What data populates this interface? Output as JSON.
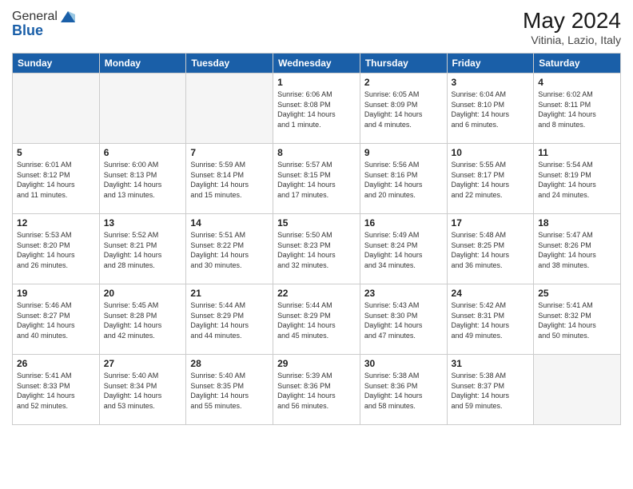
{
  "header": {
    "logo_general": "General",
    "logo_blue": "Blue",
    "month_title": "May 2024",
    "location": "Vitinia, Lazio, Italy"
  },
  "days_of_week": [
    "Sunday",
    "Monday",
    "Tuesday",
    "Wednesday",
    "Thursday",
    "Friday",
    "Saturday"
  ],
  "weeks": [
    [
      {
        "day": "",
        "info": ""
      },
      {
        "day": "",
        "info": ""
      },
      {
        "day": "",
        "info": ""
      },
      {
        "day": "1",
        "info": "Sunrise: 6:06 AM\nSunset: 8:08 PM\nDaylight: 14 hours\nand 1 minute."
      },
      {
        "day": "2",
        "info": "Sunrise: 6:05 AM\nSunset: 8:09 PM\nDaylight: 14 hours\nand 4 minutes."
      },
      {
        "day": "3",
        "info": "Sunrise: 6:04 AM\nSunset: 8:10 PM\nDaylight: 14 hours\nand 6 minutes."
      },
      {
        "day": "4",
        "info": "Sunrise: 6:02 AM\nSunset: 8:11 PM\nDaylight: 14 hours\nand 8 minutes."
      }
    ],
    [
      {
        "day": "5",
        "info": "Sunrise: 6:01 AM\nSunset: 8:12 PM\nDaylight: 14 hours\nand 11 minutes."
      },
      {
        "day": "6",
        "info": "Sunrise: 6:00 AM\nSunset: 8:13 PM\nDaylight: 14 hours\nand 13 minutes."
      },
      {
        "day": "7",
        "info": "Sunrise: 5:59 AM\nSunset: 8:14 PM\nDaylight: 14 hours\nand 15 minutes."
      },
      {
        "day": "8",
        "info": "Sunrise: 5:57 AM\nSunset: 8:15 PM\nDaylight: 14 hours\nand 17 minutes."
      },
      {
        "day": "9",
        "info": "Sunrise: 5:56 AM\nSunset: 8:16 PM\nDaylight: 14 hours\nand 20 minutes."
      },
      {
        "day": "10",
        "info": "Sunrise: 5:55 AM\nSunset: 8:17 PM\nDaylight: 14 hours\nand 22 minutes."
      },
      {
        "day": "11",
        "info": "Sunrise: 5:54 AM\nSunset: 8:19 PM\nDaylight: 14 hours\nand 24 minutes."
      }
    ],
    [
      {
        "day": "12",
        "info": "Sunrise: 5:53 AM\nSunset: 8:20 PM\nDaylight: 14 hours\nand 26 minutes."
      },
      {
        "day": "13",
        "info": "Sunrise: 5:52 AM\nSunset: 8:21 PM\nDaylight: 14 hours\nand 28 minutes."
      },
      {
        "day": "14",
        "info": "Sunrise: 5:51 AM\nSunset: 8:22 PM\nDaylight: 14 hours\nand 30 minutes."
      },
      {
        "day": "15",
        "info": "Sunrise: 5:50 AM\nSunset: 8:23 PM\nDaylight: 14 hours\nand 32 minutes."
      },
      {
        "day": "16",
        "info": "Sunrise: 5:49 AM\nSunset: 8:24 PM\nDaylight: 14 hours\nand 34 minutes."
      },
      {
        "day": "17",
        "info": "Sunrise: 5:48 AM\nSunset: 8:25 PM\nDaylight: 14 hours\nand 36 minutes."
      },
      {
        "day": "18",
        "info": "Sunrise: 5:47 AM\nSunset: 8:26 PM\nDaylight: 14 hours\nand 38 minutes."
      }
    ],
    [
      {
        "day": "19",
        "info": "Sunrise: 5:46 AM\nSunset: 8:27 PM\nDaylight: 14 hours\nand 40 minutes."
      },
      {
        "day": "20",
        "info": "Sunrise: 5:45 AM\nSunset: 8:28 PM\nDaylight: 14 hours\nand 42 minutes."
      },
      {
        "day": "21",
        "info": "Sunrise: 5:44 AM\nSunset: 8:29 PM\nDaylight: 14 hours\nand 44 minutes."
      },
      {
        "day": "22",
        "info": "Sunrise: 5:44 AM\nSunset: 8:29 PM\nDaylight: 14 hours\nand 45 minutes."
      },
      {
        "day": "23",
        "info": "Sunrise: 5:43 AM\nSunset: 8:30 PM\nDaylight: 14 hours\nand 47 minutes."
      },
      {
        "day": "24",
        "info": "Sunrise: 5:42 AM\nSunset: 8:31 PM\nDaylight: 14 hours\nand 49 minutes."
      },
      {
        "day": "25",
        "info": "Sunrise: 5:41 AM\nSunset: 8:32 PM\nDaylight: 14 hours\nand 50 minutes."
      }
    ],
    [
      {
        "day": "26",
        "info": "Sunrise: 5:41 AM\nSunset: 8:33 PM\nDaylight: 14 hours\nand 52 minutes."
      },
      {
        "day": "27",
        "info": "Sunrise: 5:40 AM\nSunset: 8:34 PM\nDaylight: 14 hours\nand 53 minutes."
      },
      {
        "day": "28",
        "info": "Sunrise: 5:40 AM\nSunset: 8:35 PM\nDaylight: 14 hours\nand 55 minutes."
      },
      {
        "day": "29",
        "info": "Sunrise: 5:39 AM\nSunset: 8:36 PM\nDaylight: 14 hours\nand 56 minutes."
      },
      {
        "day": "30",
        "info": "Sunrise: 5:38 AM\nSunset: 8:36 PM\nDaylight: 14 hours\nand 58 minutes."
      },
      {
        "day": "31",
        "info": "Sunrise: 5:38 AM\nSunset: 8:37 PM\nDaylight: 14 hours\nand 59 minutes."
      },
      {
        "day": "",
        "info": ""
      }
    ]
  ]
}
